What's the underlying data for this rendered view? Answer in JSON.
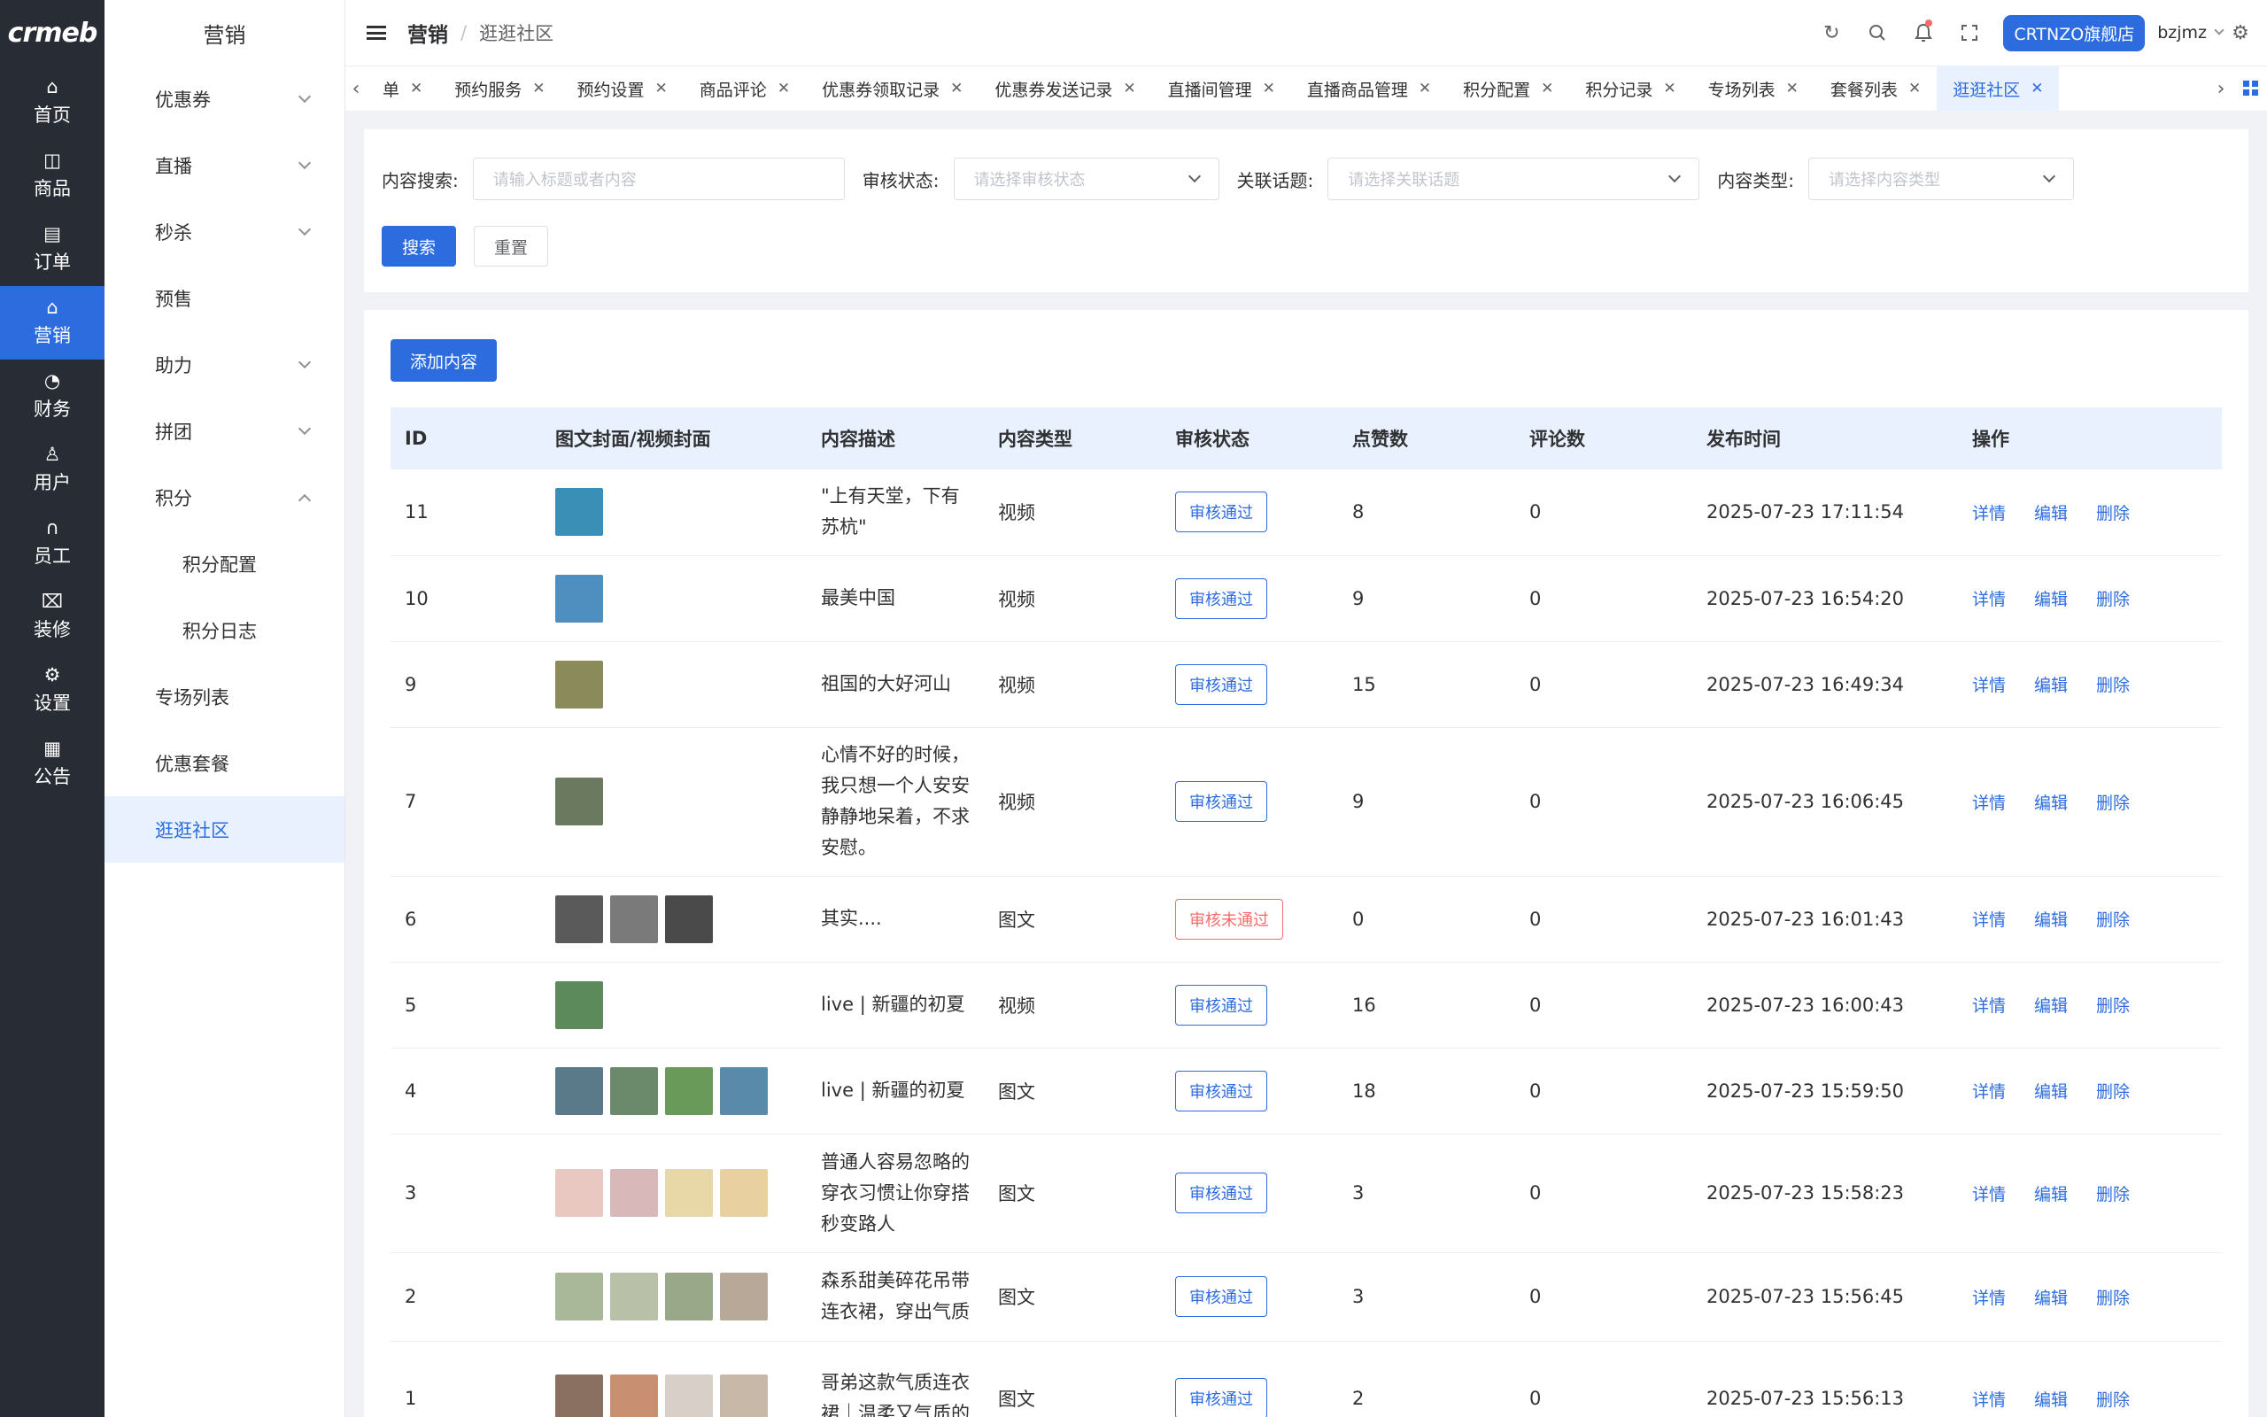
{
  "brand": {
    "logo_text": "crmeb"
  },
  "rail": [
    {
      "label": "首页",
      "icon": "home-icon",
      "glyph": "⌂"
    },
    {
      "label": "商品",
      "icon": "bag-icon",
      "glyph": "◫"
    },
    {
      "label": "订单",
      "icon": "order-icon",
      "glyph": "▤"
    },
    {
      "label": "营销",
      "icon": "marketing-icon",
      "glyph": "⌂",
      "active": true
    },
    {
      "label": "财务",
      "icon": "finance-icon",
      "glyph": "◔"
    },
    {
      "label": "用户",
      "icon": "user-icon",
      "glyph": "♙"
    },
    {
      "label": "员工",
      "icon": "headset-icon",
      "glyph": "∩"
    },
    {
      "label": "装修",
      "icon": "decorate-icon",
      "glyph": "⌧"
    },
    {
      "label": "设置",
      "icon": "gear-icon",
      "glyph": "⚙"
    },
    {
      "label": "公告",
      "icon": "notice-icon",
      "glyph": "▦"
    }
  ],
  "submenu": {
    "title": "营销",
    "items": [
      {
        "label": "优惠券",
        "chev": "down"
      },
      {
        "label": "直播",
        "chev": "down"
      },
      {
        "label": "秒杀",
        "chev": "down"
      },
      {
        "label": "预售"
      },
      {
        "label": "助力",
        "chev": "down"
      },
      {
        "label": "拼团",
        "chev": "down"
      },
      {
        "label": "积分",
        "chev": "up"
      },
      {
        "label": "积分配置",
        "child": true
      },
      {
        "label": "积分日志",
        "child": true
      },
      {
        "label": "专场列表"
      },
      {
        "label": "优惠套餐"
      },
      {
        "label": "逛逛社区",
        "active": true
      }
    ]
  },
  "header": {
    "breadcrumb_root": "营销",
    "breadcrumb_sep": "/",
    "breadcrumb_current": "逛逛社区",
    "store_label": "CRTNZO旗舰店",
    "username": "bzjmz"
  },
  "tabs": [
    {
      "label": "单"
    },
    {
      "label": "预约服务"
    },
    {
      "label": "预约设置"
    },
    {
      "label": "商品评论"
    },
    {
      "label": "优惠券领取记录"
    },
    {
      "label": "优惠券发送记录"
    },
    {
      "label": "直播间管理"
    },
    {
      "label": "直播商品管理"
    },
    {
      "label": "积分配置"
    },
    {
      "label": "积分记录"
    },
    {
      "label": "专场列表"
    },
    {
      "label": "套餐列表"
    },
    {
      "label": "逛逛社区",
      "active": true
    }
  ],
  "filters": {
    "search_label": "内容搜索:",
    "search_placeholder": "请输入标题或者内容",
    "status_label": "审核状态:",
    "status_placeholder": "请选择审核状态",
    "topic_label": "关联话题:",
    "topic_placeholder": "请选择关联话题",
    "type_label": "内容类型:",
    "type_placeholder": "请选择内容类型",
    "search_btn": "搜索",
    "reset_btn": "重置"
  },
  "add_btn": "添加内容",
  "table": {
    "headers": [
      "ID",
      "图文封面/视频封面",
      "内容描述",
      "内容类型",
      "审核状态",
      "点赞数",
      "评论数",
      "发布时间",
      "操作"
    ],
    "ops": [
      "详情",
      "编辑",
      "删除"
    ],
    "rows": [
      {
        "id": "11",
        "desc": "\"上有天堂，下有苏杭\"",
        "type": "视频",
        "status": "审核通过",
        "likes": "8",
        "comments": "0",
        "time": "2025-07-23 17:11:54",
        "thumbs": [
          "#3a8fb7"
        ]
      },
      {
        "id": "10",
        "desc": "最美中国",
        "type": "视频",
        "status": "审核通过",
        "likes": "9",
        "comments": "0",
        "time": "2025-07-23 16:54:20",
        "thumbs": [
          "#4f8fbf"
        ]
      },
      {
        "id": "9",
        "desc": "祖国的大好河山",
        "type": "视频",
        "status": "审核通过",
        "likes": "15",
        "comments": "0",
        "time": "2025-07-23 16:49:34",
        "thumbs": [
          "#8a8a5a"
        ]
      },
      {
        "id": "7",
        "desc": "心情不好的时候，我只想一个人安安静静地呆着，不求安慰。",
        "type": "视频",
        "status": "审核通过",
        "likes": "9",
        "comments": "0",
        "time": "2025-07-23 16:06:45",
        "thumbs": [
          "#6b7a5e"
        ]
      },
      {
        "id": "6",
        "desc": "其实....",
        "type": "图文",
        "status": "审核未通过",
        "rejected": true,
        "likes": "0",
        "comments": "0",
        "time": "2025-07-23 16:01:43",
        "thumbs": [
          "#5a5a5a",
          "#7a7a7a",
          "#4a4a4a"
        ]
      },
      {
        "id": "5",
        "desc": "live | 新疆的初夏",
        "type": "视频",
        "status": "审核通过",
        "likes": "16",
        "comments": "0",
        "time": "2025-07-23 16:00:43",
        "thumbs": [
          "#5d8a5a"
        ]
      },
      {
        "id": "4",
        "desc": "live | 新疆的初夏",
        "type": "图文",
        "status": "审核通过",
        "likes": "18",
        "comments": "0",
        "time": "2025-07-23 15:59:50",
        "thumbs": [
          "#5a7a8a",
          "#6b8a6b",
          "#6a9a5a",
          "#5a8aaa"
        ]
      },
      {
        "id": "3",
        "desc": "普通人容易忽略的穿衣习惯让你穿搭秒变路人",
        "type": "图文",
        "status": "审核通过",
        "likes": "3",
        "comments": "0",
        "time": "2025-07-23 15:58:23",
        "thumbs": [
          "#e8c8c0",
          "#d8b8b8",
          "#e8d8a8",
          "#e8d0a0"
        ]
      },
      {
        "id": "2",
        "desc": "森系甜美碎花吊带连衣裙，穿出气质",
        "type": "图文",
        "status": "审核通过",
        "likes": "3",
        "comments": "0",
        "time": "2025-07-23 15:56:45",
        "thumbs": [
          "#a8b898",
          "#b8c0a8",
          "#9aa88a",
          "#b8a898"
        ]
      },
      {
        "id": "1",
        "desc": "哥弟这款气质连衣裙｜温柔又气质的",
        "type": "图文",
        "status": "审核通过",
        "likes": "2",
        "comments": "0",
        "time": "2025-07-23 15:56:13",
        "thumbs": [
          "#8a7060",
          "#c89070",
          "#d8d0c8",
          "#c8b8a8"
        ]
      }
    ]
  }
}
